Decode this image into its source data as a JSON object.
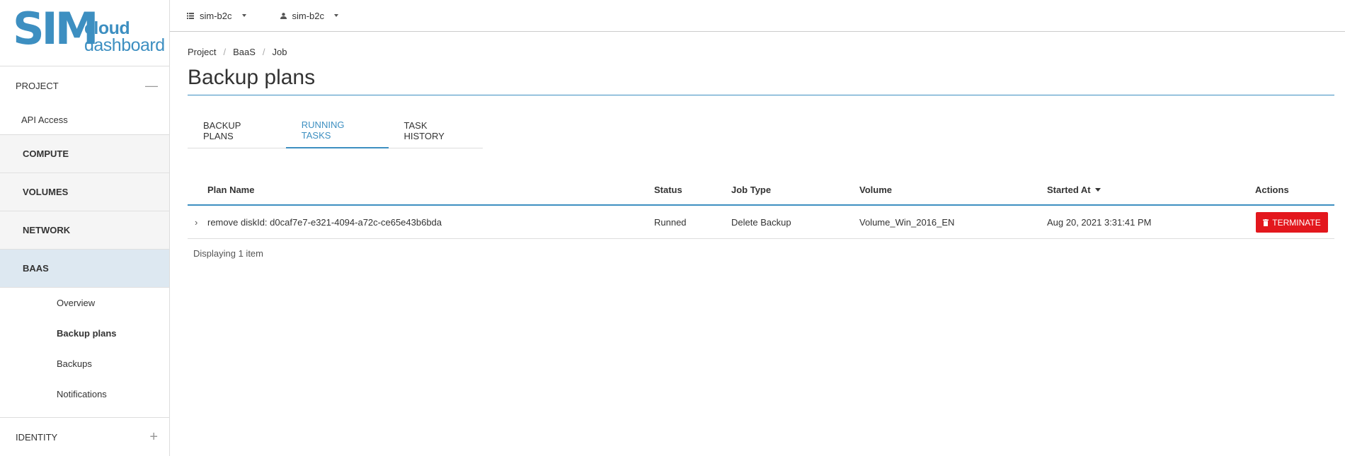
{
  "logo": {
    "sim": "SIM",
    "line1": "cloud",
    "line2": "dashboard"
  },
  "sidebar": {
    "project_label": "PROJECT",
    "project_sign": "—",
    "api_access": "API Access",
    "categories": {
      "compute": "COMPUTE",
      "volumes": "VOLUMES",
      "network": "NETWORK",
      "baas": "BAAS"
    },
    "baas_items": {
      "overview": "Overview",
      "backup_plans": "Backup plans",
      "backups": "Backups",
      "notifications": "Notifications"
    },
    "identity_label": "IDENTITY",
    "identity_sign": "+"
  },
  "topbar": {
    "project_selector": "sim-b2c",
    "user_selector": "sim-b2c"
  },
  "breadcrumb": [
    "Project",
    "BaaS",
    "Job"
  ],
  "page_title": "Backup plans",
  "tabs": {
    "backup_plans": "BACKUP PLANS",
    "running_tasks": "RUNNING TASKS",
    "task_history": "TASK HISTORY"
  },
  "table": {
    "headers": {
      "plan_name": "Plan Name",
      "status": "Status",
      "job_type": "Job Type",
      "volume": "Volume",
      "started_at": "Started At",
      "actions": "Actions"
    },
    "rows": [
      {
        "plan_name": "remove diskId: d0caf7e7-e321-4094-a72c-ce65e43b6bda",
        "status": "Runned",
        "job_type": "Delete Backup",
        "volume": "Volume_Win_2016_EN",
        "started_at": "Aug 20, 2021 3:31:41 PM",
        "action_label": "TERMINATE"
      }
    ],
    "footer": "Displaying 1 item"
  },
  "colors": {
    "accent": "#3d8fc1",
    "danger": "#e3171d"
  }
}
